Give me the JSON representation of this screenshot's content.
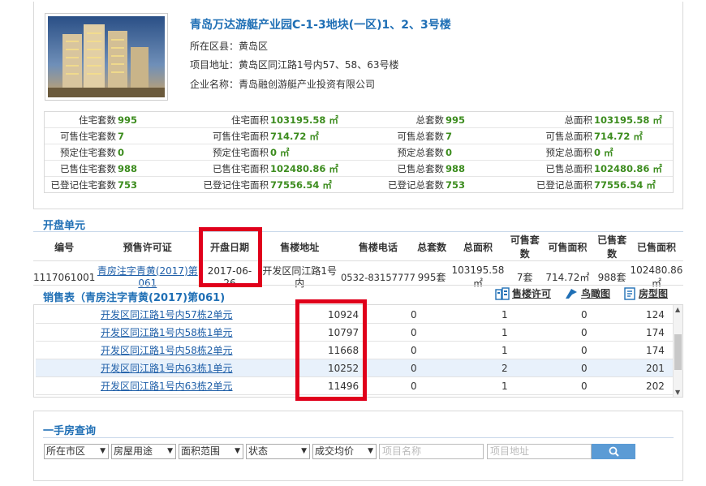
{
  "project": {
    "name": "青岛万达游艇产业园C-1-3地块(一区)1、2、3号楼",
    "district_label": "所在区县：",
    "district": "黄岛区",
    "address_label": "项目地址：",
    "address": "黄岛区同江路1号内57、58、63号楼",
    "company_label": "企业名称：",
    "company": "青岛融创游艇产业投资有限公司"
  },
  "stats": [
    [
      {
        "l": "住宅套数",
        "v": "995"
      },
      {
        "l": "住宅面积",
        "v": "103195.58 ㎡"
      },
      {
        "l": "总套数",
        "v": "995"
      },
      {
        "l": "总面积",
        "v": "103195.58 ㎡"
      }
    ],
    [
      {
        "l": "可售住宅套数",
        "v": "7"
      },
      {
        "l": "可售住宅面积",
        "v": "714.72 ㎡"
      },
      {
        "l": "可售总套数",
        "v": "7"
      },
      {
        "l": "可售总面积",
        "v": "714.72 ㎡"
      }
    ],
    [
      {
        "l": "预定住宅套数",
        "v": "0"
      },
      {
        "l": "预定住宅面积",
        "v": "0 ㎡"
      },
      {
        "l": "预定总套数",
        "v": "0"
      },
      {
        "l": "预定总面积",
        "v": "0 ㎡"
      }
    ],
    [
      {
        "l": "已售住宅套数",
        "v": "988"
      },
      {
        "l": "已售住宅面积",
        "v": "102480.86 ㎡"
      },
      {
        "l": "已售总套数",
        "v": "988"
      },
      {
        "l": "已售总面积",
        "v": "102480.86 ㎡"
      }
    ],
    [
      {
        "l": "已登记住宅套数",
        "v": "753"
      },
      {
        "l": "已登记住宅面积",
        "v": "77556.54 ㎡"
      },
      {
        "l": "已登记总套数",
        "v": "753"
      },
      {
        "l": "已登记总面积",
        "v": "77556.54 ㎡"
      }
    ]
  ],
  "units_section": {
    "title": "开盘单元",
    "headers": [
      "编号",
      "预售许可证",
      "开盘日期",
      "售楼地址",
      "售楼电话",
      "总套数",
      "总面积",
      "可售套数",
      "可售面积",
      "已售套数",
      "已售面积"
    ],
    "row": {
      "id": "1117061001",
      "permit_line1": "青房注字青黄(2017)第",
      "permit_line2": "061",
      "date_line1": "2017-06-",
      "date_line2": "26",
      "addr_line1": "开发区同江路1号",
      "addr_line2": "内",
      "phone": "0532-83157777",
      "total_units": "995套",
      "total_area": "103195.58㎡",
      "avail_units": "7套",
      "avail_area": "714.72㎡",
      "sold_units": "988套",
      "sold_area": "102480.86㎡"
    }
  },
  "sales": {
    "title": "销售表（青房注字青黄(2017)第061)",
    "links": {
      "permit": "售楼许可",
      "aerial": "鸟瞰图",
      "plan": "房型图"
    },
    "rows": [
      {
        "name": "开发区同江路1号内57栋2单元",
        "price": "10924",
        "c1": "0",
        "c2": "1",
        "c3": "0",
        "c4": "124"
      },
      {
        "name": "开发区同江路1号内58栋1单元",
        "price": "10797",
        "c1": "0",
        "c2": "1",
        "c3": "0",
        "c4": "174"
      },
      {
        "name": "开发区同江路1号内58栋2单元",
        "price": "11668",
        "c1": "0",
        "c2": "1",
        "c3": "0",
        "c4": "174"
      },
      {
        "name": "开发区同江路1号内63栋1单元",
        "price": "10252",
        "c1": "0",
        "c2": "2",
        "c3": "0",
        "c4": "201"
      },
      {
        "name": "开发区同江路1号内63栋2单元",
        "price": "11496",
        "c1": "0",
        "c2": "1",
        "c3": "0",
        "c4": "202"
      }
    ]
  },
  "search": {
    "title": "一手房查询",
    "selects": [
      "所在市区",
      "房屋用途",
      "面积范围",
      "状态",
      "成交均价"
    ],
    "name_placeholder": "项目名称",
    "addr_placeholder": "项目地址"
  },
  "colors": {
    "highlight": "#e0001b",
    "accent": "#1f5fa8",
    "search_button": "#5b9bd5"
  }
}
